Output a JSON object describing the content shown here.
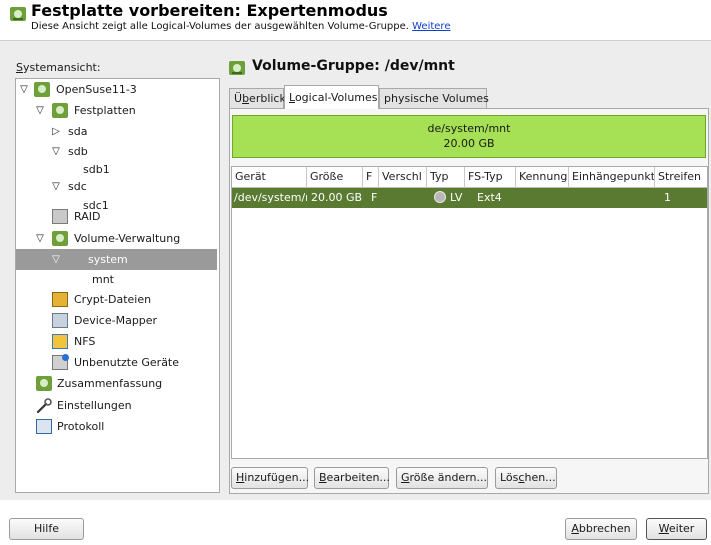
{
  "header": {
    "title": "Festplatte vorbereiten: Expertenmodus",
    "subtitle": "Diese Ansicht zeigt alle Logical-Volumes der ausgewählten Volume-Gruppe.",
    "more_link": "Weitere"
  },
  "sidebar": {
    "label_mnemonic": "S",
    "label_rest": "ystemansicht:",
    "items": [
      {
        "label": "OpenSuse11-3",
        "icon": "opensuse-icon"
      },
      {
        "label": "Festplatten",
        "icon": "opensuse-icon"
      },
      {
        "label": "sda",
        "icon": ""
      },
      {
        "label": "sdb",
        "icon": ""
      },
      {
        "label": "sdb1",
        "icon": ""
      },
      {
        "label": "sdc",
        "icon": ""
      },
      {
        "label": "sdc1",
        "icon": ""
      },
      {
        "label": "RAID",
        "icon": "raid-icon"
      },
      {
        "label": "Volume-Verwaltung",
        "icon": "opensuse-icon"
      },
      {
        "label": "system",
        "icon": ""
      },
      {
        "label": "mnt",
        "icon": ""
      },
      {
        "label": "Crypt-Dateien",
        "icon": "crypt-icon"
      },
      {
        "label": "Device-Mapper",
        "icon": "device-mapper-icon"
      },
      {
        "label": "NFS",
        "icon": "nfs-icon"
      },
      {
        "label": "Unbenutzte Geräte",
        "icon": "unused-devices-icon"
      },
      {
        "label": "Zusammenfassung",
        "icon": "opensuse-icon"
      },
      {
        "label": "Einstellungen",
        "icon": "wrench-icon"
      },
      {
        "label": "Protokoll",
        "icon": "log-icon"
      }
    ]
  },
  "main": {
    "title": "Volume-Gruppe: /dev/mnt",
    "tabs": [
      {
        "pre": "Ü",
        "mn": "b",
        "post": "erblick"
      },
      {
        "pre": "",
        "mn": "L",
        "post": "ogical-Volumes"
      },
      {
        "pre": "physische Volumes",
        "mn": "",
        "post": ""
      }
    ],
    "bar": {
      "name": "de/system/mnt",
      "size": "20.00 GB"
    },
    "table": {
      "columns": [
        "Gerät",
        "Größe",
        "F",
        "Verschl",
        "Typ",
        "FS-Typ",
        "Kennung",
        "Einhängepunkt",
        "Streifen"
      ],
      "rows": [
        [
          "/dev/system/mnt",
          "20.00 GB",
          "F",
          "",
          "LV",
          "Ext4",
          "",
          "",
          "1"
        ]
      ]
    },
    "buttons": [
      {
        "pre": "",
        "mn": "H",
        "post": "inzufügen..."
      },
      {
        "pre": "",
        "mn": "B",
        "post": "earbeiten..."
      },
      {
        "pre": "",
        "mn": "G",
        "post": "röße ändern..."
      },
      {
        "pre": "Lös",
        "mn": "c",
        "post": "hen..."
      }
    ]
  },
  "footer": {
    "help": "Hilfe",
    "cancel": {
      "pre": "",
      "mn": "A",
      "post": "bbrechen"
    },
    "next": {
      "pre": "",
      "mn": "W",
      "post": "eiter"
    }
  },
  "colors": {
    "accent_bar": "#a6e055",
    "selection": "#5b7a31",
    "tree_selection": "#9a9a9a"
  }
}
